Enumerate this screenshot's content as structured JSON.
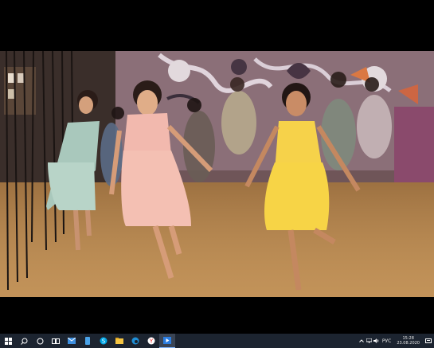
{
  "window": {
    "content": "video-player-fullscreen"
  },
  "video": {
    "scene": "dancers-in-pastel-dresses"
  },
  "taskbar": {
    "start_icon": "windows-start-icon",
    "pinned": [
      {
        "name": "search-icon"
      },
      {
        "name": "cortana-icon"
      },
      {
        "name": "task-view-icon"
      },
      {
        "name": "mail-icon"
      },
      {
        "name": "phone-icon"
      },
      {
        "name": "skype-icon"
      },
      {
        "name": "file-explorer-icon"
      },
      {
        "name": "edge-icon"
      },
      {
        "name": "yandex-icon"
      },
      {
        "name": "media-player-icon",
        "active": true
      }
    ],
    "tray": {
      "icons": [
        "chevron-up-icon",
        "network-icon",
        "volume-icon"
      ],
      "language": "РУС",
      "time": "15:28",
      "date": "23.08.2020"
    },
    "colors": {
      "background": "#1c2430",
      "accent": "#7fb6ff"
    }
  }
}
